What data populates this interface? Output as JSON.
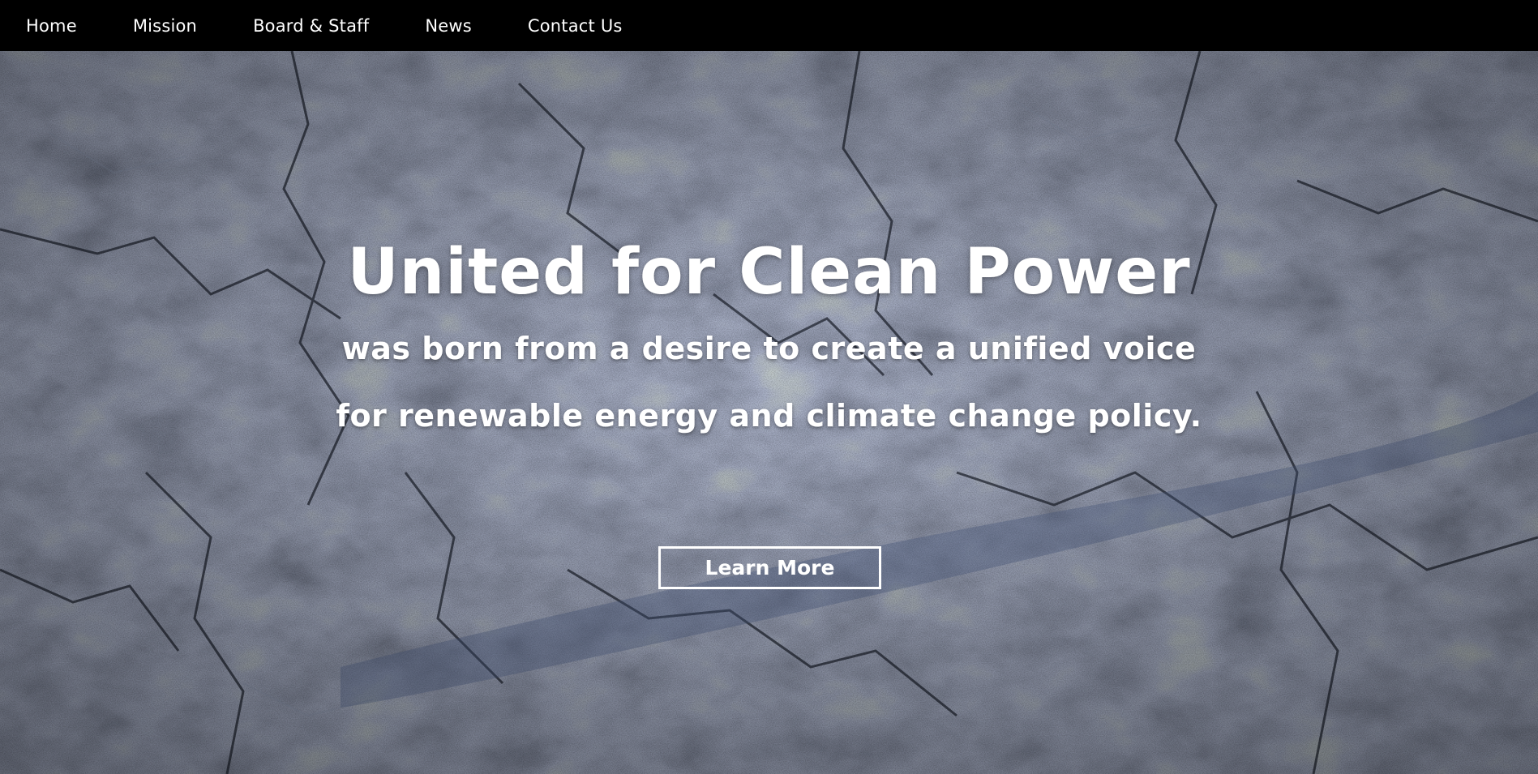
{
  "nav": {
    "items": [
      {
        "label": "Home"
      },
      {
        "label": "Mission"
      },
      {
        "label": "Board & Staff"
      },
      {
        "label": "News"
      },
      {
        "label": "Contact Us"
      }
    ]
  },
  "hero": {
    "title": "United for Clean Power",
    "line1": "was born from a desire to create a unified voice",
    "line2": "for renewable energy and climate change policy.",
    "button_label": "Learn More"
  },
  "colors": {
    "nav_background": "#000000",
    "text": "#ffffff",
    "rock_base": "#4f5a73",
    "rock_light": "#8d9ab8",
    "rock_dark": "#2a3040"
  }
}
